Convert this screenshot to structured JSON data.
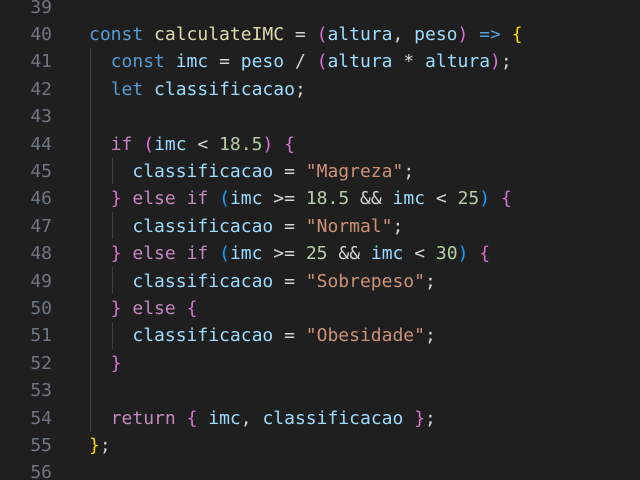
{
  "editor": {
    "lines": [
      {
        "number": "39",
        "tokens": []
      },
      {
        "number": "40",
        "tokens": [
          {
            "t": "const",
            "c": "kw"
          },
          {
            "t": " ",
            "c": "op"
          },
          {
            "t": "calculateIMC",
            "c": "fn"
          },
          {
            "t": " = ",
            "c": "op"
          },
          {
            "t": "(",
            "c": "b2"
          },
          {
            "t": "altura",
            "c": "var"
          },
          {
            "t": ", ",
            "c": "op"
          },
          {
            "t": "peso",
            "c": "var"
          },
          {
            "t": ")",
            "c": "b2"
          },
          {
            "t": " ",
            "c": "op"
          },
          {
            "t": "=>",
            "c": "kw"
          },
          {
            "t": " ",
            "c": "op"
          },
          {
            "t": "{",
            "c": "b1"
          }
        ]
      },
      {
        "number": "41",
        "tokens": [
          {
            "t": "  ",
            "c": "ind"
          },
          {
            "t": "const",
            "c": "kw"
          },
          {
            "t": " ",
            "c": "op"
          },
          {
            "t": "imc",
            "c": "var"
          },
          {
            "t": " = ",
            "c": "op"
          },
          {
            "t": "peso",
            "c": "var"
          },
          {
            "t": " / ",
            "c": "op"
          },
          {
            "t": "(",
            "c": "b2"
          },
          {
            "t": "altura",
            "c": "var"
          },
          {
            "t": " * ",
            "c": "op"
          },
          {
            "t": "altura",
            "c": "var"
          },
          {
            "t": ")",
            "c": "b2"
          },
          {
            "t": ";",
            "c": "op"
          }
        ]
      },
      {
        "number": "42",
        "tokens": [
          {
            "t": "  ",
            "c": "ind"
          },
          {
            "t": "let",
            "c": "kw"
          },
          {
            "t": " ",
            "c": "op"
          },
          {
            "t": "classificacao",
            "c": "var"
          },
          {
            "t": ";",
            "c": "op"
          }
        ]
      },
      {
        "number": "43",
        "tokens": []
      },
      {
        "number": "44",
        "tokens": [
          {
            "t": "  ",
            "c": "ind"
          },
          {
            "t": "if",
            "c": "ctl"
          },
          {
            "t": " ",
            "c": "op"
          },
          {
            "t": "(",
            "c": "b2"
          },
          {
            "t": "imc",
            "c": "var"
          },
          {
            "t": " < ",
            "c": "op"
          },
          {
            "t": "18.5",
            "c": "num"
          },
          {
            "t": ")",
            "c": "b2"
          },
          {
            "t": " ",
            "c": "op"
          },
          {
            "t": "{",
            "c": "b2"
          }
        ]
      },
      {
        "number": "45",
        "tokens": [
          {
            "t": "    ",
            "c": "ind"
          },
          {
            "t": "classificacao",
            "c": "var"
          },
          {
            "t": " = ",
            "c": "op"
          },
          {
            "t": "\"Magreza\"",
            "c": "str"
          },
          {
            "t": ";",
            "c": "op"
          }
        ]
      },
      {
        "number": "46",
        "tokens": [
          {
            "t": "  ",
            "c": "ind"
          },
          {
            "t": "}",
            "c": "b2"
          },
          {
            "t": " ",
            "c": "op"
          },
          {
            "t": "else",
            "c": "ctl"
          },
          {
            "t": " ",
            "c": "op"
          },
          {
            "t": "if",
            "c": "ctl"
          },
          {
            "t": " ",
            "c": "op"
          },
          {
            "t": "(",
            "c": "b3"
          },
          {
            "t": "imc",
            "c": "var"
          },
          {
            "t": " >= ",
            "c": "op"
          },
          {
            "t": "18.5",
            "c": "num"
          },
          {
            "t": " && ",
            "c": "op"
          },
          {
            "t": "imc",
            "c": "var"
          },
          {
            "t": " < ",
            "c": "op"
          },
          {
            "t": "25",
            "c": "num"
          },
          {
            "t": ")",
            "c": "b3"
          },
          {
            "t": " ",
            "c": "op"
          },
          {
            "t": "{",
            "c": "b2"
          }
        ]
      },
      {
        "number": "47",
        "tokens": [
          {
            "t": "    ",
            "c": "ind"
          },
          {
            "t": "classificacao",
            "c": "var"
          },
          {
            "t": " = ",
            "c": "op"
          },
          {
            "t": "\"Normal\"",
            "c": "str"
          },
          {
            "t": ";",
            "c": "op"
          }
        ]
      },
      {
        "number": "48",
        "tokens": [
          {
            "t": "  ",
            "c": "ind"
          },
          {
            "t": "}",
            "c": "b2"
          },
          {
            "t": " ",
            "c": "op"
          },
          {
            "t": "else",
            "c": "ctl"
          },
          {
            "t": " ",
            "c": "op"
          },
          {
            "t": "if",
            "c": "ctl"
          },
          {
            "t": " ",
            "c": "op"
          },
          {
            "t": "(",
            "c": "b3"
          },
          {
            "t": "imc",
            "c": "var"
          },
          {
            "t": " >= ",
            "c": "op"
          },
          {
            "t": "25",
            "c": "num"
          },
          {
            "t": " && ",
            "c": "op"
          },
          {
            "t": "imc",
            "c": "var"
          },
          {
            "t": " < ",
            "c": "op"
          },
          {
            "t": "30",
            "c": "num"
          },
          {
            "t": ")",
            "c": "b3"
          },
          {
            "t": " ",
            "c": "op"
          },
          {
            "t": "{",
            "c": "b2"
          }
        ]
      },
      {
        "number": "49",
        "tokens": [
          {
            "t": "    ",
            "c": "ind"
          },
          {
            "t": "classificacao",
            "c": "var"
          },
          {
            "t": " = ",
            "c": "op"
          },
          {
            "t": "\"Sobrepeso\"",
            "c": "str"
          },
          {
            "t": ";",
            "c": "op"
          }
        ]
      },
      {
        "number": "50",
        "tokens": [
          {
            "t": "  ",
            "c": "ind"
          },
          {
            "t": "}",
            "c": "b2"
          },
          {
            "t": " ",
            "c": "op"
          },
          {
            "t": "else",
            "c": "ctl"
          },
          {
            "t": " ",
            "c": "op"
          },
          {
            "t": "{",
            "c": "b2"
          }
        ]
      },
      {
        "number": "51",
        "tokens": [
          {
            "t": "    ",
            "c": "ind"
          },
          {
            "t": "classificacao",
            "c": "var"
          },
          {
            "t": " = ",
            "c": "op"
          },
          {
            "t": "\"Obesidade\"",
            "c": "str"
          },
          {
            "t": ";",
            "c": "op"
          }
        ]
      },
      {
        "number": "52",
        "tokens": [
          {
            "t": "  ",
            "c": "ind"
          },
          {
            "t": "}",
            "c": "b2"
          }
        ]
      },
      {
        "number": "53",
        "tokens": []
      },
      {
        "number": "54",
        "tokens": [
          {
            "t": "  ",
            "c": "ind"
          },
          {
            "t": "return",
            "c": "ctl"
          },
          {
            "t": " ",
            "c": "op"
          },
          {
            "t": "{",
            "c": "b2"
          },
          {
            "t": " ",
            "c": "op"
          },
          {
            "t": "imc",
            "c": "var"
          },
          {
            "t": ", ",
            "c": "op"
          },
          {
            "t": "classificacao",
            "c": "var"
          },
          {
            "t": " ",
            "c": "op"
          },
          {
            "t": "}",
            "c": "b2"
          },
          {
            "t": ";",
            "c": "op"
          }
        ]
      },
      {
        "number": "55",
        "tokens": [
          {
            "t": "}",
            "c": "b1"
          },
          {
            "t": ";",
            "c": "op"
          }
        ]
      },
      {
        "number": "56",
        "tokens": []
      }
    ]
  },
  "theme": {
    "background": "#1f1f1f",
    "line_number": "#6e7681",
    "keyword": "#569cd6",
    "control": "#c586c0",
    "function": "#dcdcaa",
    "variable": "#9cdcfe",
    "string": "#ce9178",
    "number": "#b5cea8",
    "bracket_level1": "#ffd700",
    "bracket_level2": "#da70d6",
    "bracket_level3": "#179fff"
  }
}
